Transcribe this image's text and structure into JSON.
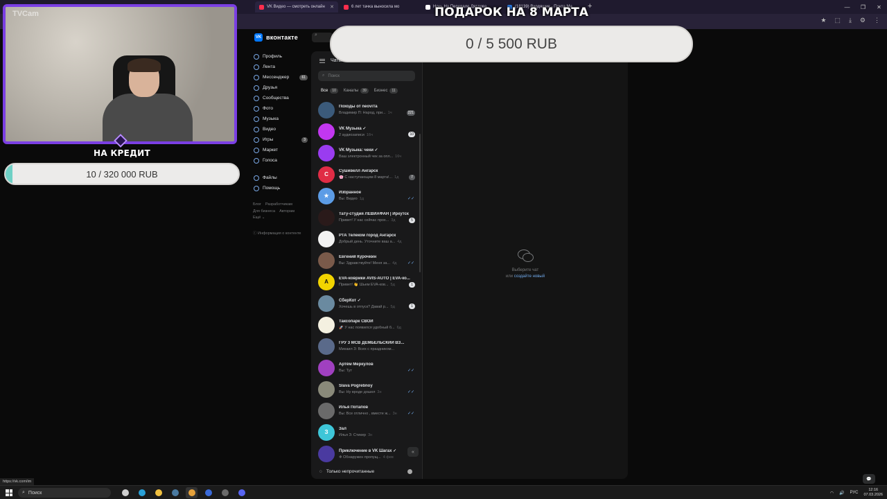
{
  "browser": {
    "tabs": [
      {
        "label": "VK Видео — смотреть онлайн",
        "active": true
      },
      {
        "label": "6 лет тачка выносила мо",
        "active": false
      },
      {
        "label": "Ночь На Перевале Дятлова",
        "active": false
      },
      {
        "label": "(18139) Входящие - Почта Ма",
        "active": false
      }
    ],
    "new_tab": "+",
    "window_controls": [
      "—",
      "❐",
      "✕"
    ],
    "toolbar_icons": [
      "★",
      "⬚",
      "⤓",
      "⚙",
      "⋮"
    ]
  },
  "vk": {
    "logo_mark": "VK",
    "logo_text": "вконтакте",
    "nav": [
      {
        "label": "Профиль",
        "icon": "profile-icon"
      },
      {
        "label": "Лента",
        "icon": "feed-icon"
      },
      {
        "label": "Мессенджер",
        "icon": "messenger-icon",
        "badge": "61"
      },
      {
        "label": "Друзья",
        "icon": "friends-icon"
      },
      {
        "label": "Сообщества",
        "icon": "communities-icon"
      },
      {
        "label": "Фото",
        "icon": "photo-icon"
      },
      {
        "label": "Музыка",
        "icon": "music-icon"
      },
      {
        "label": "Видео",
        "icon": "video-icon"
      },
      {
        "label": "Игры",
        "icon": "games-icon",
        "badge": "3"
      },
      {
        "label": "Маркет",
        "icon": "market-icon"
      },
      {
        "label": "Голоса",
        "icon": "votes-icon"
      }
    ],
    "nav_secondary": [
      {
        "label": "Файлы",
        "icon": "files-icon"
      },
      {
        "label": "Помощь",
        "icon": "help-icon"
      }
    ],
    "footer_links": [
      "Блог",
      "Разработчикам",
      "Для бизнеса",
      "Авторам",
      "Ещё ⌄"
    ],
    "content_info": "Информация о контенте"
  },
  "messenger": {
    "header": "Чаты",
    "search_placeholder": "Поиск",
    "filters": [
      {
        "label": "Все",
        "count": "10",
        "active": true
      },
      {
        "label": "Каналы",
        "count": "39",
        "active": false
      },
      {
        "label": "Бизнес",
        "count": "11",
        "active": false
      }
    ],
    "chats": [
      {
        "name": "Походы от neoviTa",
        "preview": "Владимир П: Народ, при...",
        "time": "1ч",
        "unread": "221",
        "muted": true,
        "color": "#3b5a7a",
        "initial": ""
      },
      {
        "name": "VK Музыка ✓",
        "preview": "2 аудиозаписи",
        "time": "16ч",
        "unread": "10",
        "muted": false,
        "color": "#c237f0",
        "initial": ""
      },
      {
        "name": "VK Музыка: чеки ✓",
        "preview": "Ваш электронный чек за опл...",
        "time": "16ч",
        "unread": "",
        "muted": false,
        "color": "#9a3cf0",
        "initial": ""
      },
      {
        "name": "Сушивелл Ангарск",
        "preview": "🌸 С наступающим 8 марта!...",
        "time": "1д",
        "unread": "7",
        "muted": true,
        "color": "#e02c45",
        "initial": "C"
      },
      {
        "name": "Избранное",
        "preview": "Вы: Видео",
        "time": "1д",
        "unread": "",
        "muted": false,
        "check": true,
        "color": "#5c9ce6",
        "initial": "★"
      },
      {
        "name": "Тату-студия ЛЕВИАФАН | Иркутск",
        "preview": "Привет! У нас сейчас прох...",
        "time": "3д",
        "unread": "5",
        "muted": false,
        "color": "#2a1a1a",
        "initial": ""
      },
      {
        "name": "РТА Телеком город Ангарск",
        "preview": "Добрый день. Уточните ваш а...",
        "time": "4д",
        "unread": "",
        "muted": false,
        "color": "#f2f2f2",
        "initial": ""
      },
      {
        "name": "Евгений Курочкин",
        "preview": "Вы: Здравствуйте! Меня за...",
        "time": "4д",
        "unread": "",
        "muted": false,
        "check": true,
        "color": "#7a5a4a",
        "initial": ""
      },
      {
        "name": "EVA-коврики AVIS-AUTO | EVA-ко...",
        "preview": "Привет! 👋 Шьем EVA-ков...",
        "time": "5д",
        "unread": "1",
        "muted": false,
        "color": "#f2d400",
        "initial": "A"
      },
      {
        "name": "СберКот ✓",
        "preview": "Хочешь в отпуск? Давай р...",
        "time": "5д",
        "unread": "1",
        "muted": false,
        "color": "#6a8aa0",
        "initial": ""
      },
      {
        "name": "Таксопарк СВОИ",
        "preview": "🚀 У нас появился удобный б...",
        "time": "6д",
        "unread": "",
        "muted": false,
        "color": "#f4f0e0",
        "initial": ""
      },
      {
        "name": "ГРУ 3 МСВ ДЕМБЕЛЬСКИЙ ВЗ...",
        "preview": "Михаил З: Всех с праздником...",
        "time": "",
        "unread": "",
        "muted": false,
        "color": "#5a6a8a",
        "initial": ""
      },
      {
        "name": "Артём Меркулов",
        "preview": "Вы: Тут",
        "time": "",
        "unread": "",
        "muted": false,
        "check": true,
        "color": "#a040c0",
        "initial": ""
      },
      {
        "name": "Slava Pogrebnoy",
        "preview": "Вы: Ну вроде дошел",
        "time": "3н",
        "unread": "",
        "muted": false,
        "check": true,
        "color": "#8a8a7a",
        "initial": ""
      },
      {
        "name": "Илья Потапов",
        "preview": "Вы: Все отлично , вместе ж...",
        "time": "3н",
        "unread": "",
        "muted": false,
        "check": true,
        "color": "#6a6a6a",
        "initial": ""
      },
      {
        "name": "Зал",
        "preview": "Илья З: Стикер",
        "time": "3н",
        "unread": "",
        "muted": false,
        "color": "#3ec6d8",
        "initial": "З"
      },
      {
        "name": "Приключение в VK Шагах ✓",
        "preview": "❄ Обнаружен пропущ...",
        "time": "4 фев",
        "unread": "",
        "muted": false,
        "color": "#4a3aa0",
        "initial": ""
      }
    ],
    "only_unread": "Только непрочитанные",
    "collapse_icon": "«",
    "empty_line1": "Выберите чат",
    "empty_line2_prefix": "или",
    "empty_link": "создайте новый"
  },
  "overlay": {
    "cam_watermark": "TVCam",
    "credit_title": "НА КРЕДИТ",
    "credit_amount": "10 / 320 000 RUB",
    "credit_progress": 0.03,
    "gift_title": "ПОДАРОК НА 8 МАРТА",
    "gift_amount": "0 / 5 500 RUB",
    "gift_progress": 0
  },
  "status_url": "https://vk.com/im",
  "taskbar": {
    "search_placeholder": "Поиск",
    "apps": [
      {
        "name": "task-view-icon",
        "color": "#cfcfcf"
      },
      {
        "name": "edge-icon",
        "color": "#2aa1d8"
      },
      {
        "name": "explorer-icon",
        "color": "#f0c040"
      },
      {
        "name": "steam-icon",
        "color": "#4a7aa0"
      },
      {
        "name": "chrome-icon",
        "color": "#e6a23c",
        "active": true
      },
      {
        "name": "app-blue-icon",
        "color": "#3a6ad8"
      },
      {
        "name": "obs-icon",
        "color": "#6a6a6a"
      },
      {
        "name": "discord-icon",
        "color": "#5865f2"
      }
    ],
    "lang": "РУС",
    "time": "12:16",
    "date": "07.03.2026"
  },
  "colors": {
    "accent": "#0077ff",
    "overlay_frame": "#7b3fe4",
    "link": "#71aaeb"
  }
}
